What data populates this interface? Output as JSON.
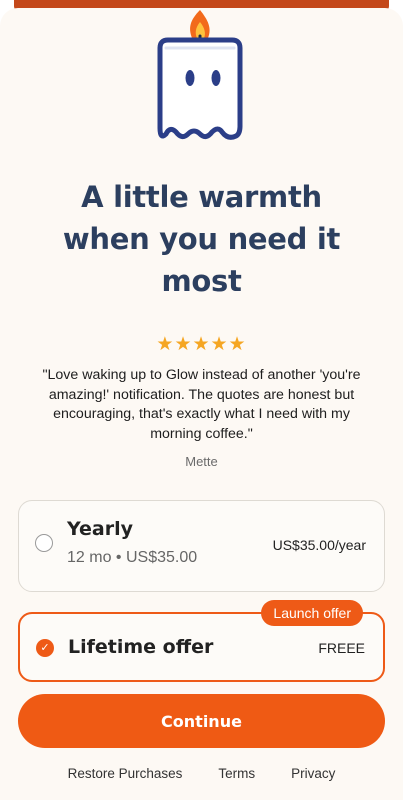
{
  "icons": {
    "mascot": "candle-ghost-icon",
    "rating": "star-icon",
    "selected": "check-icon"
  },
  "colors": {
    "accent": "#ef5a14",
    "title": "#2c3f5f",
    "stars": "#f5a623",
    "background": "#fdf9f4"
  },
  "header": {
    "title_lines": [
      "A little warmth",
      "when you need it",
      "most"
    ]
  },
  "review": {
    "stars": "★★★★★",
    "rating": 5,
    "quote": "\"Love waking up to Glow instead of another 'you're amazing!' notification. The quotes are honest but encouraging, that's exactly what I need with my morning coffee.\"",
    "author": "Mette"
  },
  "plans": [
    {
      "name": "Yearly",
      "subtitle": "12 mo • US$35.00",
      "price": "US$35.00/year",
      "selected": false
    },
    {
      "name": "Lifetime offer",
      "price": "FREEE",
      "badge": "Launch offer",
      "selected": true
    }
  ],
  "cta": {
    "label": "Continue"
  },
  "footer": {
    "links": [
      "Restore Purchases",
      "Terms",
      "Privacy"
    ]
  }
}
